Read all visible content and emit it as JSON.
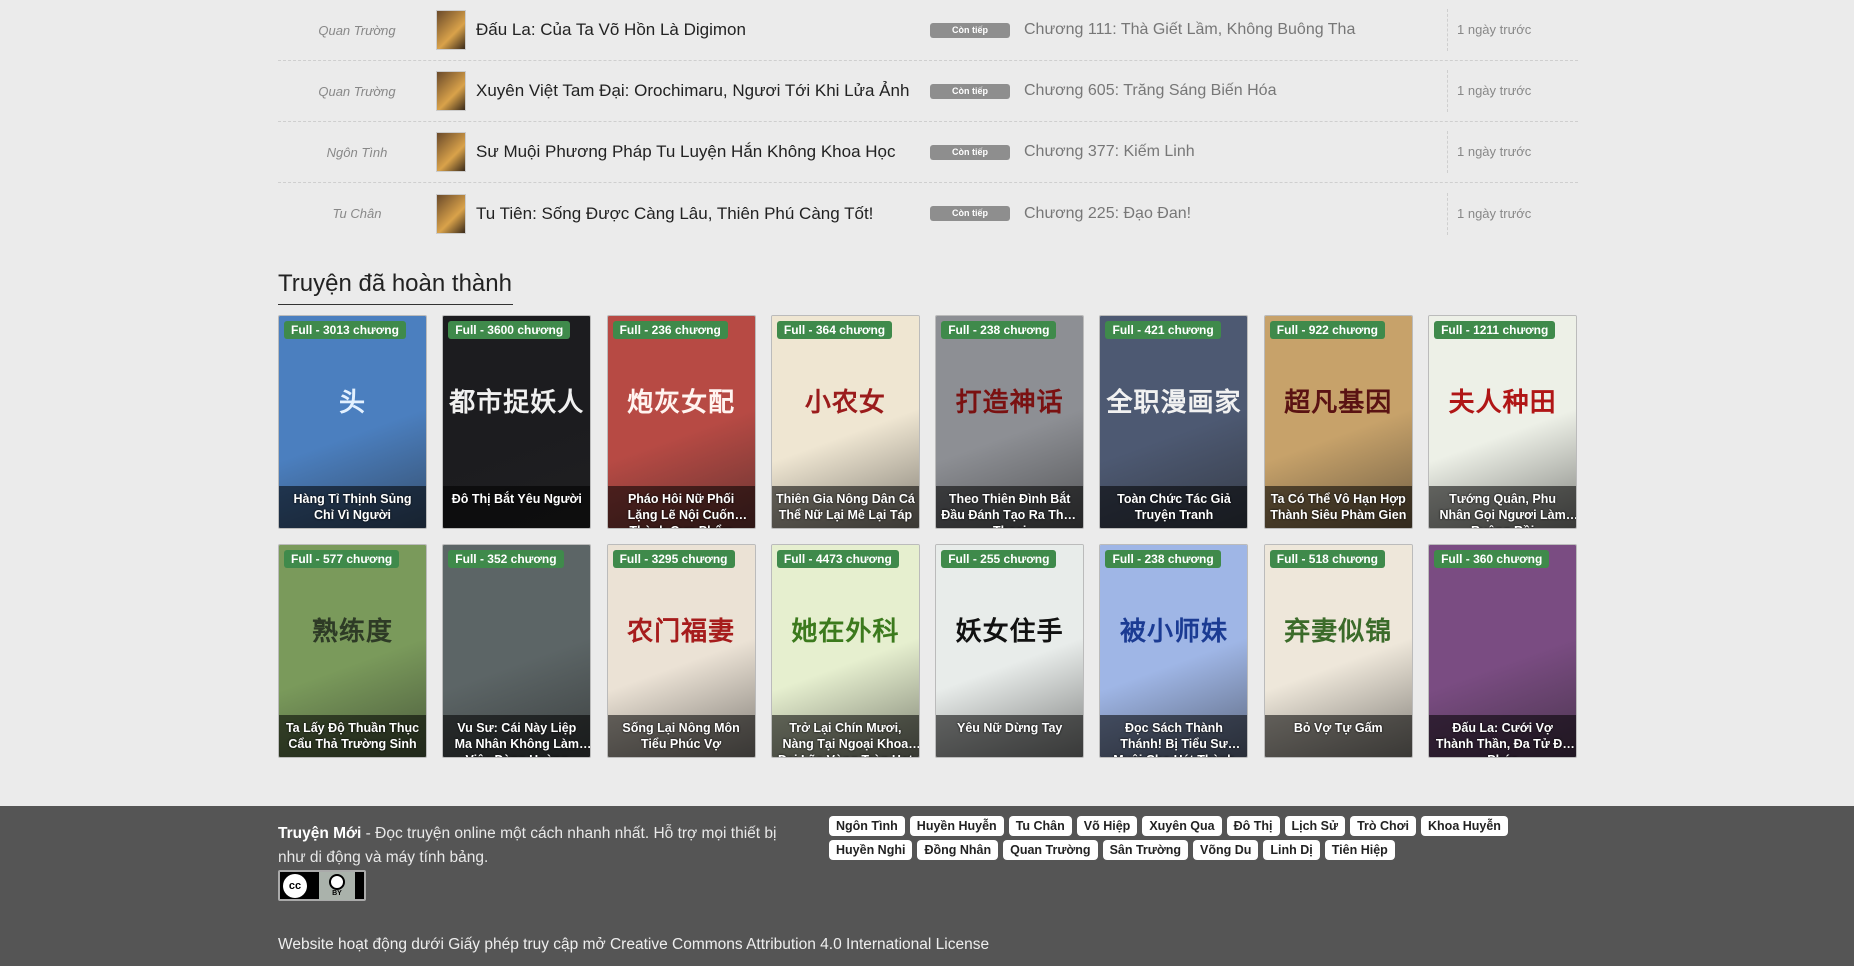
{
  "updates": [
    {
      "category": "Quan Trường",
      "title": "Đấu La: Của Ta Võ Hồn Là Digimon",
      "status": "Còn tiếp",
      "chapter": "Chương 111: Thà Giết Lầm, Không Buông Tha",
      "time": "1 ngày trước"
    },
    {
      "category": "Quan Trường",
      "title": "Xuyên Việt Tam Đại: Orochimaru, Ngươi Tới Khi Lửa Ảnh",
      "status": "Còn tiếp",
      "chapter": "Chương 605: Trăng Sáng Biến Hóa",
      "time": "1 ngày trước"
    },
    {
      "category": "Ngôn Tình",
      "title": "Sư Muội Phương Pháp Tu Luyện Hắn Không Khoa Học",
      "status": "Còn tiếp",
      "chapter": "Chương 377: Kiếm Linh",
      "time": "1 ngày trước"
    },
    {
      "category": "Tu Chân",
      "title": "Tu Tiên: Sống Được Càng Lâu, Thiên Phú Càng Tốt!",
      "status": "Còn tiếp",
      "chapter": "Chương 225: Đạo Đan!",
      "time": "1 ngày trước"
    }
  ],
  "completed": {
    "heading": "Truyện đã hoàn thành",
    "cards": [
      {
        "chip": "Full - 3013 chương",
        "title": "Hàng Tỉ Thịnh Sủng Chỉ Vì Người",
        "cover_text": "头",
        "bg": "#4b7fbf",
        "fg": "#e3f1ff"
      },
      {
        "chip": "Full - 3600 chương",
        "title": "Đô Thị Bắt Yêu Người",
        "cover_text": "都市捉妖人",
        "bg": "#1c1c1f",
        "fg": "#f0f0f0"
      },
      {
        "chip": "Full - 236 chương",
        "title": "Pháo Hôi Nữ Phối Lặng Lẽ Nội Cuốn Thành Cực Phẩm",
        "cover_text": "炮灰女配",
        "bg": "#b74a44",
        "fg": "#fff4f0"
      },
      {
        "chip": "Full - 364 chương",
        "title": "Thiên Gia Nông Dân Cá Thể Nữ Lại Mê Lại Táp",
        "cover_text": "小农女",
        "bg": "#efe6d2",
        "fg": "#9b1c1c"
      },
      {
        "chip": "Full - 238 chương",
        "title": "Theo Thiên Đình Bắt Đầu Đánh Tạo Ra Thần Thoại",
        "cover_text": "打造神话",
        "bg": "#8d8f94",
        "fg": "#7a1111"
      },
      {
        "chip": "Full - 421 chương",
        "title": "Toàn Chức Tác Giả Truyện Tranh",
        "cover_text": "全职漫画家",
        "bg": "#4d5972",
        "fg": "#f1f1f1"
      },
      {
        "chip": "Full - 922 chương",
        "title": "Ta Có Thể Vô Hạn Hợp Thành Siêu Phàm Gien",
        "cover_text": "超凡基因",
        "bg": "#c7a26a",
        "fg": "#5a1313"
      },
      {
        "chip": "Full - 1211 chương",
        "title": "Tướng Quân, Phu Nhân Gọi Ngươi Làm Ruộng Rồi",
        "cover_text": "夫人种田",
        "bg": "#edf0e7",
        "fg": "#b01616"
      },
      {
        "chip": "Full - 577 chương",
        "title": "Ta Lấy Độ Thuần Thục Cẩu Thả Trường Sinh",
        "cover_text": "熟练度",
        "bg": "#7a9a5b",
        "fg": "#2e3b26"
      },
      {
        "chip": "Full - 352 chương",
        "title": "Vu Sư: Cái Này Liệp Ma Nhân Không Làm Việc Đàng Hoàng",
        "cover_text": "",
        "bg": "#5c6566",
        "fg": "#ddd"
      },
      {
        "chip": "Full - 3295 chương",
        "title": "Sống Lại Nông Môn Tiểu Phúc Vợ",
        "cover_text": "农门福妻",
        "bg": "#ebe2d5",
        "fg": "#a61c1c"
      },
      {
        "chip": "Full - 4473 chương",
        "title": "Trở Lại Chín Mươi, Nàng Tại Ngoại Khoa Đại Lão Vòng Tròn Hot",
        "cover_text": "她在外科",
        "bg": "#e6efcf",
        "fg": "#3c7a1d"
      },
      {
        "chip": "Full - 255 chương",
        "title": "Yêu Nữ Dừng Tay",
        "cover_text": "妖女住手",
        "bg": "#e8ecea",
        "fg": "#111"
      },
      {
        "chip": "Full - 238 chương",
        "title": "Đọc Sách Thành Thánh! Bị Tiểu Sư Muội Cho Hát Thành Đại Năng",
        "cover_text": "被小师妹",
        "bg": "#9fb6e6",
        "fg": "#1b3b93"
      },
      {
        "chip": "Full - 518 chương",
        "title": "Bỏ Vợ Tự Gấm",
        "cover_text": "弃妻似锦",
        "bg": "#eee7da",
        "fg": "#3b6b2a"
      },
      {
        "chip": "Full - 360 chương",
        "title": "Đấu La: Cưới Vợ Thành Thần, Đa Tử Đa Phúc",
        "cover_text": "",
        "bg": "#7a4c82",
        "fg": "#ffd23f"
      }
    ]
  },
  "footer": {
    "site": "Truyện Mới",
    "desc": " - Đọc truyện online một cách nhanh nhất. Hỗ trợ mọi thiết bị như di động và máy tính bảng.",
    "tags": [
      "Ngôn Tình",
      "Huyền Huyễn",
      "Tu Chân",
      "Võ Hiệp",
      "Xuyên Qua",
      "Đô Thị",
      "Lịch Sử",
      "Trò Chơi",
      "Khoa Huyễn",
      "Huyền Nghi",
      "Đồng Nhân",
      "Quan Trường",
      "Sân Trường",
      "Võng Du",
      "Linh Dị",
      "Tiên Hiệp"
    ],
    "license": "Website hoạt động dưới Giấy phép truy cập mở Creative Commons Attribution 4.0 International License",
    "cc_badge": {
      "cc": "cc",
      "by": "BY"
    }
  },
  "colors": {
    "chip": "#3f8a4b",
    "badge": "#8e8e8e",
    "footer_bg": "#555555"
  }
}
